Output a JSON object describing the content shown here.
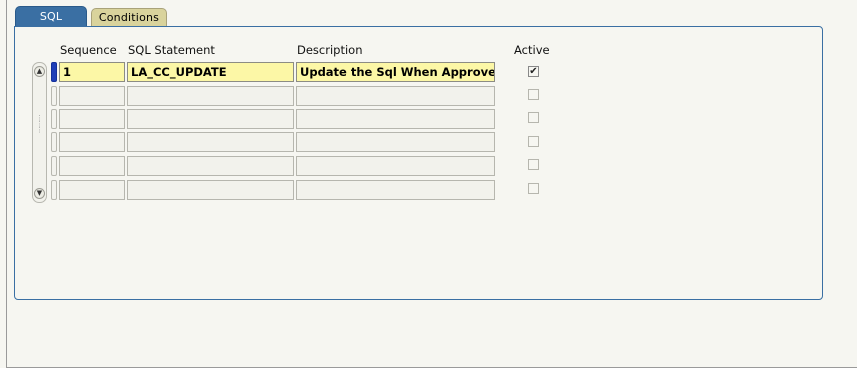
{
  "tabs": {
    "sql_label": "SQL",
    "conditions_label": "Conditions"
  },
  "columns": {
    "sequence": "Sequence",
    "sql_statement": "SQL Statement",
    "description": "Description",
    "active": "Active"
  },
  "rows": [
    {
      "sequence": "1",
      "sql_statement": "LA_CC_UPDATE",
      "description": "Update the Sql When Approvec",
      "active": true
    },
    {
      "sequence": "",
      "sql_statement": "",
      "description": "",
      "active": false
    },
    {
      "sequence": "",
      "sql_statement": "",
      "description": "",
      "active": false
    },
    {
      "sequence": "",
      "sql_statement": "",
      "description": "",
      "active": false
    },
    {
      "sequence": "",
      "sql_statement": "",
      "description": "",
      "active": false
    },
    {
      "sequence": "",
      "sql_statement": "",
      "description": "",
      "active": false
    }
  ],
  "icons": {
    "scroll_up": "scroll-up-arrow-icon",
    "scroll_down": "scroll-down-arrow-icon",
    "checkmark": "checkmark-icon"
  },
  "colors": {
    "active_tab": "#3a6fa3",
    "inactive_tab": "#d9d39c",
    "current_row_field": "#fcf7a6",
    "current_record_indicator": "#1f3fb8"
  }
}
